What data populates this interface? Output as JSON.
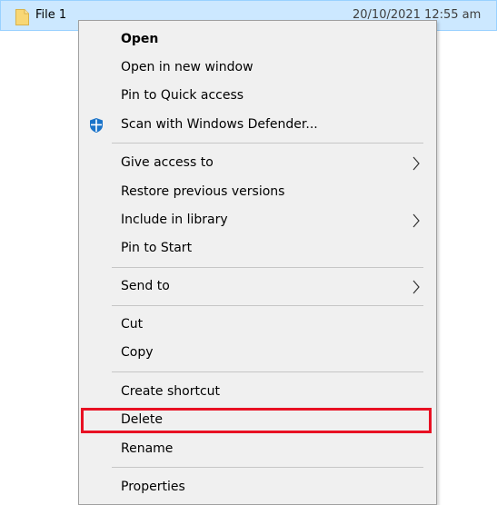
{
  "file": {
    "name": "File 1",
    "date": "20/10/2021 12:55 am",
    "icon": "folder-icon"
  },
  "menu": {
    "items": [
      {
        "label": "Open",
        "bold": true
      },
      {
        "label": "Open in new window"
      },
      {
        "label": "Pin to Quick access"
      },
      {
        "label": "Scan with Windows Defender...",
        "icon": "windows-defender-icon"
      },
      {
        "label": "Give access to",
        "submenu": true
      },
      {
        "label": "Restore previous versions"
      },
      {
        "label": "Include in library",
        "submenu": true
      },
      {
        "label": "Pin to Start"
      },
      {
        "label": "Send to",
        "submenu": true
      },
      {
        "label": "Cut"
      },
      {
        "label": "Copy"
      },
      {
        "label": "Create shortcut"
      },
      {
        "label": "Delete",
        "highlighted": true
      },
      {
        "label": "Rename"
      },
      {
        "label": "Properties"
      }
    ]
  },
  "colors": {
    "selection": "#cce8ff",
    "menu_background": "#f0f0f0",
    "highlight_border": "#e81123",
    "defender_blue": "#1a73c9",
    "folder_yellow": "#f8d775"
  }
}
